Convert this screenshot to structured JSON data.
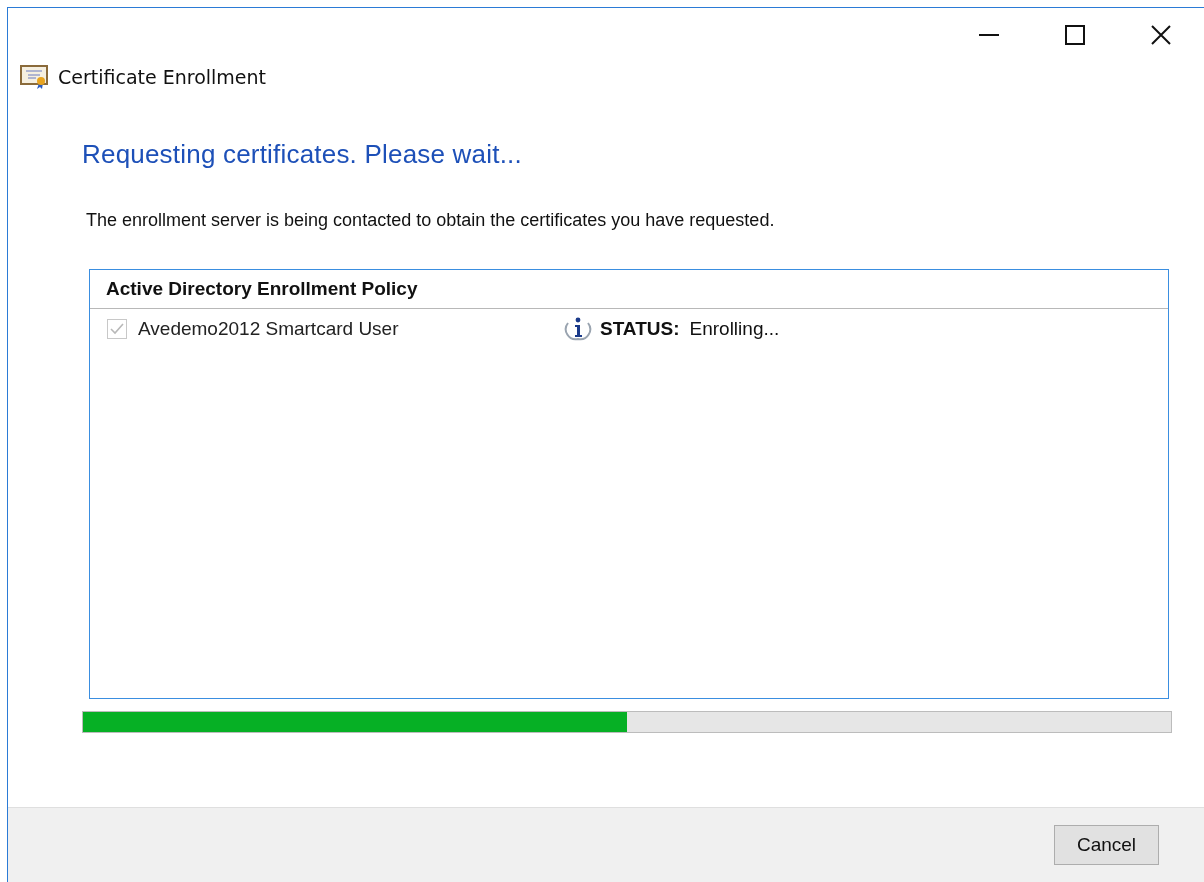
{
  "window": {
    "title": "Certificate Enrollment"
  },
  "heading": "Requesting certificates. Please wait...",
  "description": "The enrollment server is being contacted to obtain the certificates you have requested.",
  "policy": {
    "title": "Active Directory Enrollment Policy",
    "items": [
      {
        "name": "Avedemo2012 Smartcard User",
        "checked": true,
        "disabled": true,
        "status_label": "STATUS:",
        "status_value": "Enrolling..."
      }
    ]
  },
  "progress": {
    "level": 0.5
  },
  "buttons": [
    "Cancel"
  ]
}
